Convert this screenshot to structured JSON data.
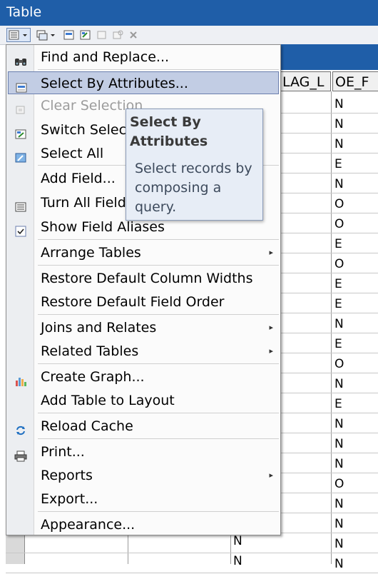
{
  "window": {
    "title": "Table"
  },
  "grid": {
    "columns": [
      "LAG_L",
      "OE_F"
    ],
    "left_col_values": [
      "N",
      "N"
    ],
    "right_col_values": [
      "N",
      "N",
      "N",
      "E",
      "N",
      "O",
      "O",
      "E",
      "O",
      "E",
      "E",
      "N",
      "E",
      "O",
      "N",
      "E",
      "N",
      "N",
      "N",
      "O",
      "N",
      "N",
      "N",
      "N"
    ]
  },
  "menu": {
    "items": [
      {
        "label": "Find and Replace...",
        "icon": "binoculars-icon"
      },
      {
        "label": "Select By Attributes...",
        "icon": "select-by-attributes-icon",
        "highlighted": true
      },
      {
        "label": "Clear Selection",
        "icon": "clear-selection-icon",
        "disabled": true
      },
      {
        "label": "Switch Selection",
        "icon": "switch-selection-icon"
      },
      {
        "label": "Select All",
        "icon": "select-all-icon"
      },
      {
        "label": "Add Field...",
        "icon": ""
      },
      {
        "label": "Turn All Fields On",
        "icon": "turn-fields-on-icon"
      },
      {
        "label": "Show Field Aliases",
        "icon": "checkbox-icon"
      },
      {
        "label": "Arrange Tables",
        "icon": "",
        "submenu": true
      },
      {
        "label": "Restore Default Column Widths",
        "icon": ""
      },
      {
        "label": "Restore Default Field Order",
        "icon": ""
      },
      {
        "label": "Joins and Relates",
        "icon": "",
        "submenu": true
      },
      {
        "label": "Related Tables",
        "icon": "",
        "submenu": true
      },
      {
        "label": "Create Graph...",
        "icon": "bar-chart-icon"
      },
      {
        "label": "Add Table to Layout",
        "icon": ""
      },
      {
        "label": "Reload Cache",
        "icon": "reload-icon"
      },
      {
        "label": "Print...",
        "icon": "printer-icon"
      },
      {
        "label": "Reports",
        "icon": "",
        "submenu": true
      },
      {
        "label": "Export...",
        "icon": ""
      },
      {
        "label": "Appearance...",
        "icon": ""
      }
    ],
    "submenu_arrow": "▸"
  },
  "tooltip": {
    "title": "Select By Attributes",
    "body": "Select records by composing a query."
  },
  "colors": {
    "titlebar": "#1f5ea8",
    "highlight": "#c2cde4",
    "tooltip_bg": "#e7edf6"
  }
}
